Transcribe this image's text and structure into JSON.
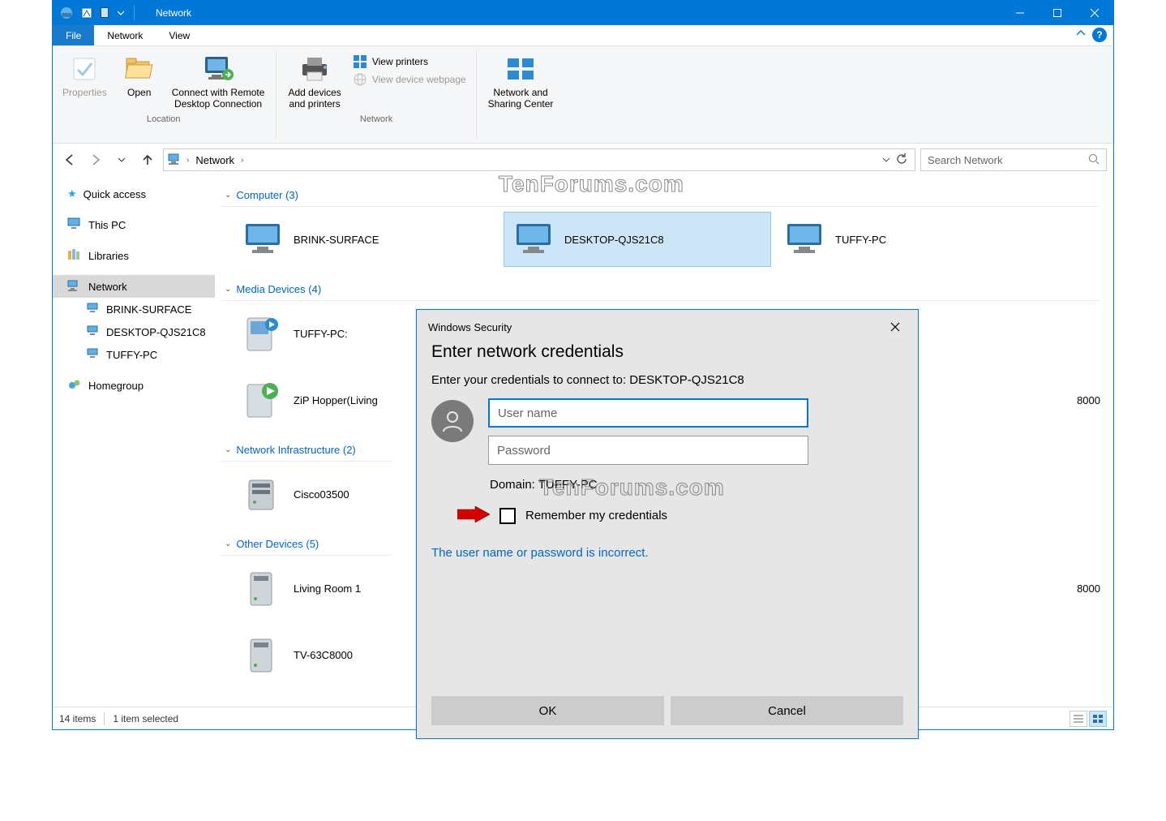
{
  "window": {
    "title": "Network"
  },
  "menu": {
    "file": "File",
    "tab_network": "Network",
    "tab_view": "View"
  },
  "ribbon": {
    "properties": "Properties",
    "open": "Open",
    "connect_rdp": "Connect with Remote\nDesktop Connection",
    "group_location": "Location",
    "add_devices": "Add devices\nand printers",
    "view_printers": "View printers",
    "view_device_webpage": "View device webpage",
    "group_network": "Network",
    "net_sharing": "Network and\nSharing Center"
  },
  "address": {
    "crumb": "Network"
  },
  "search": {
    "placeholder": "Search Network"
  },
  "sidebar": {
    "quick_access": "Quick access",
    "this_pc": "This PC",
    "libraries": "Libraries",
    "network": "Network",
    "n1": "BRINK-SURFACE",
    "n2": "DESKTOP-QJS21C8",
    "n3": "TUFFY-PC",
    "homegroup": "Homegroup"
  },
  "groups": {
    "computer": "Computer (3)",
    "media": "Media Devices (4)",
    "infra": "Network Infrastructure (2)",
    "other": "Other Devices (5)"
  },
  "computers": {
    "c1": "BRINK-SURFACE",
    "c2": "DESKTOP-QJS21C8",
    "c3": "TUFFY-PC"
  },
  "media": {
    "m1": "TUFFY-PC:",
    "m2": "ZiP Hopper(Living",
    "m2cut": "8000"
  },
  "infra": {
    "i1": "Cisco03500"
  },
  "other": {
    "o1": "Living Room 1",
    "o2": "TV-63C8000",
    "o3": "8000"
  },
  "status": {
    "count": "14 items",
    "sel": "1 item selected"
  },
  "dialog": {
    "caption": "Windows Security",
    "title": "Enter network credentials",
    "subtitle": "Enter your credentials to connect to: DESKTOP-QJS21C8",
    "user_ph": "User name",
    "pwd_ph": "Password",
    "domain": "Domain: TUFFY-PC",
    "remember": "Remember my credentials",
    "error": "The user name or password is incorrect.",
    "ok": "OK",
    "cancel": "Cancel"
  },
  "watermark": "TenForums.com"
}
